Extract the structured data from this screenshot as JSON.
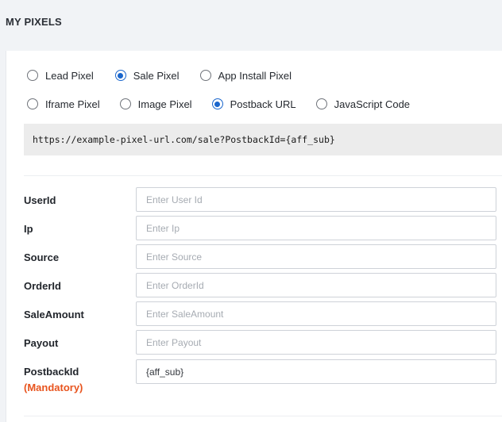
{
  "header": {
    "title": "MY PIXELS"
  },
  "pixel_types": {
    "row1": [
      {
        "label": "Lead Pixel",
        "checked": false
      },
      {
        "label": "Sale Pixel",
        "checked": true
      },
      {
        "label": "App Install Pixel",
        "checked": false
      }
    ],
    "row2": [
      {
        "label": "Iframe Pixel",
        "checked": false
      },
      {
        "label": "Image Pixel",
        "checked": false
      },
      {
        "label": "Postback URL",
        "checked": true
      },
      {
        "label": "JavaScript Code",
        "checked": false
      }
    ]
  },
  "pixel_url": "https://example-pixel-url.com/sale?PostbackId={aff_sub}",
  "colors": {
    "accent": "#1a66cc",
    "mandatory": "#e8541e"
  },
  "fields": [
    {
      "label": "UserId",
      "placeholder": "Enter User Id",
      "value": ""
    },
    {
      "label": "Ip",
      "placeholder": "Enter Ip",
      "value": ""
    },
    {
      "label": "Source",
      "placeholder": "Enter Source",
      "value": ""
    },
    {
      "label": "OrderId",
      "placeholder": "Enter OrderId",
      "value": ""
    },
    {
      "label": "SaleAmount",
      "placeholder": "Enter SaleAmount",
      "value": ""
    },
    {
      "label": "Payout",
      "placeholder": "Enter Payout",
      "value": ""
    },
    {
      "label": "PostbackId",
      "sublabel": "(Mandatory)",
      "placeholder": "",
      "value": "{aff_sub}"
    }
  ]
}
